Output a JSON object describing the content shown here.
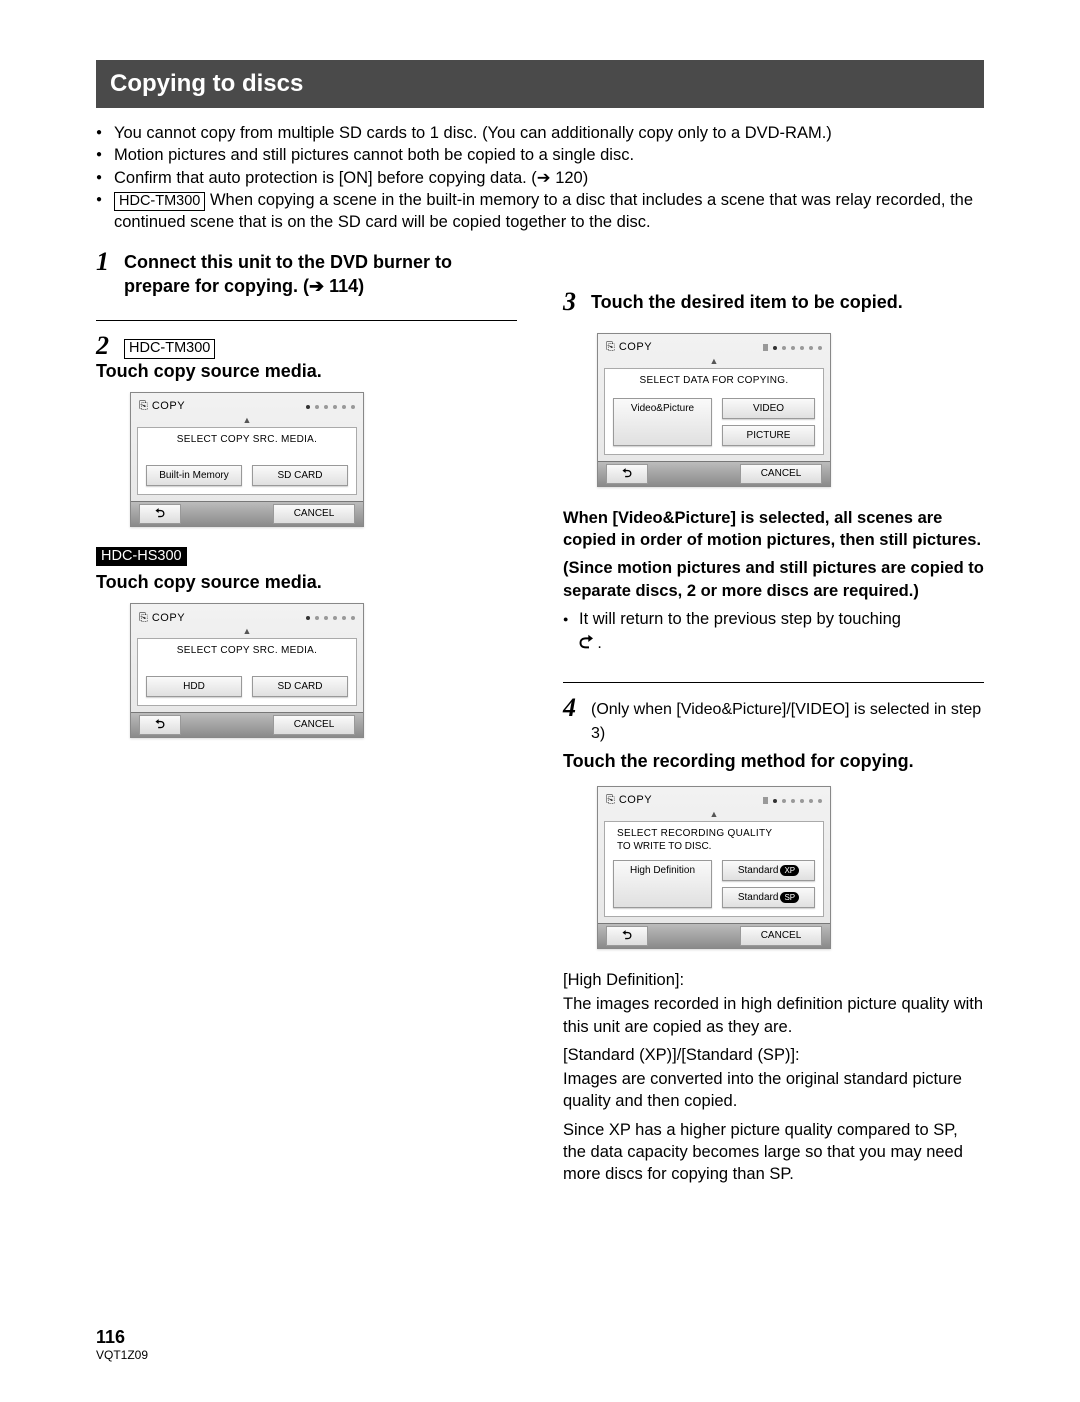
{
  "title": "Copying to discs",
  "notes": [
    "You cannot copy from multiple SD cards to 1 disc. (You can additionally copy only to a DVD-RAM.)",
    "Motion pictures and still pictures cannot both be copied to a single disc.",
    "Confirm that auto protection is [ON] before copying data. (➔ 120)"
  ],
  "note4_model": "HDC-TM300",
  "note4_text": " When copying a scene in the built-in memory to a disc that includes a scene that was relay recorded, the continued scene that is on the SD card will be copied together to the disc.",
  "step1": {
    "num": "1",
    "text": "Connect this unit to the DVD burner to prepare for copying. (➔ 114)"
  },
  "step2": {
    "num": "2",
    "model_a": "HDC-TM300",
    "line_a": "Touch copy source media.",
    "model_b": "HDC-HS300",
    "line_b": "Touch copy source media."
  },
  "step3": {
    "num": "3",
    "text": "Touch the desired item to be copied.",
    "after_b1": "When [Video&Picture] is selected, all scenes are copied in order of motion pictures, then still pictures.",
    "after_b2": "(Since motion pictures and still pictures are copied to separate discs, 2 or more discs are required.)",
    "bullet": "It will return to the previous step by touching",
    "bullet_tail": "."
  },
  "step4": {
    "num": "4",
    "pre": "(Only when [Video&Picture]/[VIDEO] is selected in step 3)",
    "text": "Touch the recording method for copying.",
    "p_hd_label": "[High Definition]:",
    "p_hd_text": "The images recorded in high definition picture quality with this unit are copied as they are.",
    "p_std_label": "[Standard (XP)]/[Standard (SP)]:",
    "p_std_text1": "Images are converted into the original standard picture quality and then copied.",
    "p_std_text2": "Since XP has a higher picture quality compared to SP, the data capacity becomes large so that you may need more discs for copying than SP."
  },
  "panelA": {
    "copy": "COPY",
    "inner_title": "SELECT COPY SRC. MEDIA.",
    "btn1": "Built-in Memory",
    "btn2": "SD CARD",
    "cancel": "CANCEL"
  },
  "panelB": {
    "copy": "COPY",
    "inner_title": "SELECT COPY SRC. MEDIA.",
    "btn1": "HDD",
    "btn2": "SD CARD",
    "cancel": "CANCEL"
  },
  "panelC": {
    "copy": "COPY",
    "inner_title": "SELECT DATA FOR COPYING.",
    "btn1": "Video&Picture",
    "btn2": "VIDEO",
    "btn3": "PICTURE",
    "cancel": "CANCEL"
  },
  "panelD": {
    "copy": "COPY",
    "inner_title": "SELECT RECORDING QUALITY",
    "inner_sub": "TO WRITE TO DISC.",
    "btn1": "High Definition",
    "btn2": "Standard",
    "btn2_badge": "XP",
    "btn3": "Standard",
    "btn3_badge": "SP",
    "cancel": "CANCEL"
  },
  "page_number": "116",
  "doc_code": "VQT1Z09"
}
